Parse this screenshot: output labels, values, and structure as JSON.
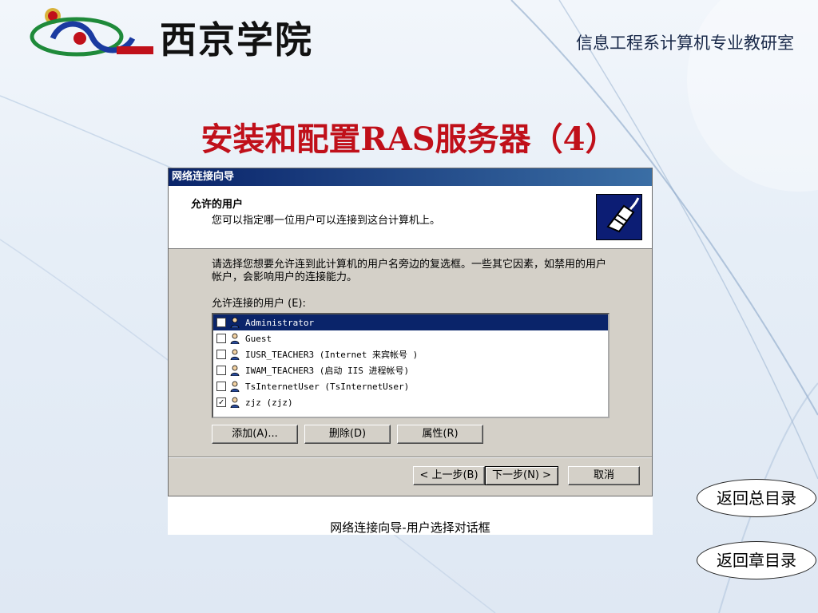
{
  "header": {
    "school_name": "西京学院",
    "department": "信息工程系计算机专业教研室"
  },
  "slide": {
    "title": "安装和配置RAS服务器（4）",
    "caption": "网络连接向导-用户选择对话框"
  },
  "dialog": {
    "title": "网络连接向导",
    "heading": "允许的用户",
    "subheading": "您可以指定哪一位用户可以连接到这台计算机上。",
    "instructions": "请选择您想要允许连到此计算机的用户名旁边的复选框。一些其它因素，如禁用的用户帐户，会影响用户的连接能力。",
    "list_label": "允许连接的用户 (E):",
    "users": [
      {
        "name": "Administrator",
        "checked": false,
        "selected": true
      },
      {
        "name": "Guest",
        "checked": false,
        "selected": false
      },
      {
        "name": "IUSR_TEACHER3 (Internet 来宾帐号 )",
        "checked": false,
        "selected": false
      },
      {
        "name": "IWAM_TEACHER3 (启动 IIS 进程帐号)",
        "checked": false,
        "selected": false
      },
      {
        "name": "TsInternetUser (TsInternetUser)",
        "checked": false,
        "selected": false
      },
      {
        "name": "zjz (zjz)",
        "checked": true,
        "selected": false
      }
    ],
    "buttons": {
      "add": "添加(A)...",
      "delete": "删除(D)",
      "properties": "属性(R)",
      "back": "< 上一步(B)",
      "next": "下一步(N) >",
      "cancel": "取消"
    }
  },
  "nav": {
    "main_toc": "返回总目录",
    "chapter_toc": "返回章目录"
  },
  "colors": {
    "title_red": "#c0101a",
    "titlebar_blue": "#0a246a",
    "dialog_gray": "#d4d0c8"
  }
}
